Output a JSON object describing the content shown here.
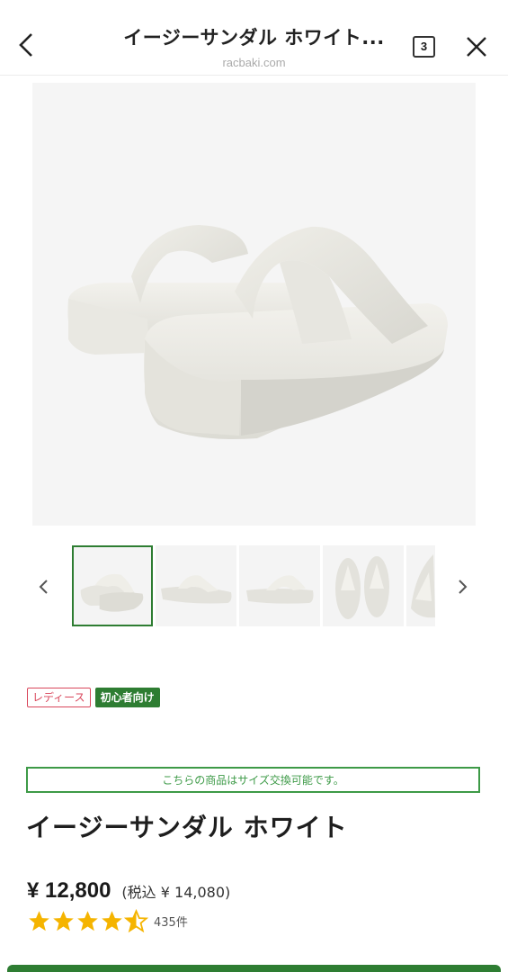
{
  "header": {
    "title": "イージーサンダル ホワイト...",
    "url": "racbaki.com",
    "tab_count": "3"
  },
  "hero": {
    "image_alt": "white sandal product image"
  },
  "thumbnails": {
    "count": 5,
    "active_index": 0
  },
  "badges": {
    "ladies": "レディース",
    "beginner": "初心者向け"
  },
  "notice": "こちらの商品はサイズ交換可能です。",
  "product": {
    "title": "イージーサンダル ホワイト",
    "price": "¥ 12,800",
    "price_with_tax": "(税込 ¥ 14,080)",
    "rating": 4.5,
    "review_count": "435件"
  },
  "colors": {
    "accent_green": "#2e7d32",
    "notice_green": "#3d9a47",
    "ladies_pink": "#d9465b",
    "star_yellow": "#f5b400"
  }
}
